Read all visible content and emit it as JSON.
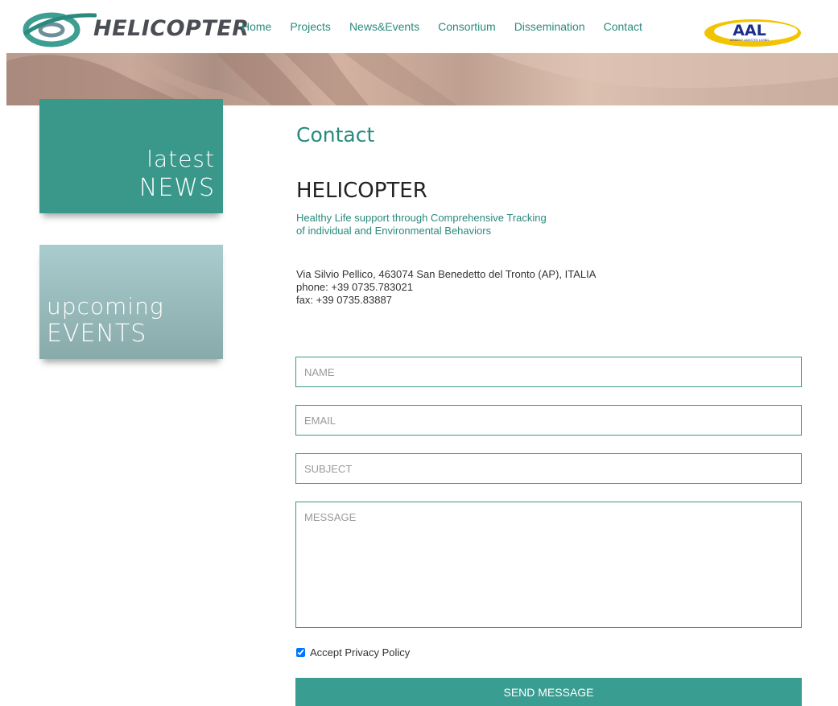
{
  "header": {
    "logo_text": "HELICOPTER",
    "nav": [
      {
        "label": "Home"
      },
      {
        "label": "Projects"
      },
      {
        "label": "News&Events"
      },
      {
        "label": "Consortium"
      },
      {
        "label": "Dissemination"
      },
      {
        "label": "Contact"
      }
    ],
    "partner_logo": {
      "text": "AAL",
      "subtext": "AMBIENT ASSISTED LIVING"
    }
  },
  "sidebar": {
    "news": {
      "line1": "latest",
      "line2": "NEWS"
    },
    "events": {
      "line1": "upcoming",
      "line2": "EVENTS"
    }
  },
  "main": {
    "title": "Contact",
    "org_name": "HELICOPTER",
    "tagline_line1": "Healthy Life support through Comprehensive Tracking",
    "tagline_line2": "of individual and Environmental Behaviors",
    "address": "Via Silvio Pellico, 463074 San Benedetto del Tronto (AP), ITALIA",
    "phone": "phone: +39 0735.783021",
    "fax": "fax: +39 0735.83887"
  },
  "form": {
    "name_placeholder": "NAME",
    "email_placeholder": "EMAIL",
    "subject_placeholder": "SUBJECT",
    "message_placeholder": "MESSAGE",
    "privacy_label": "Accept Privacy Policy",
    "privacy_checked": true,
    "submit_label": "SEND MESSAGE"
  },
  "colors": {
    "teal": "#3a988b",
    "teal_text": "#2a8a7e",
    "events_tile": "#9bbcbd",
    "aal_yellow": "#f2c400",
    "aal_blue": "#1a2f8a"
  }
}
